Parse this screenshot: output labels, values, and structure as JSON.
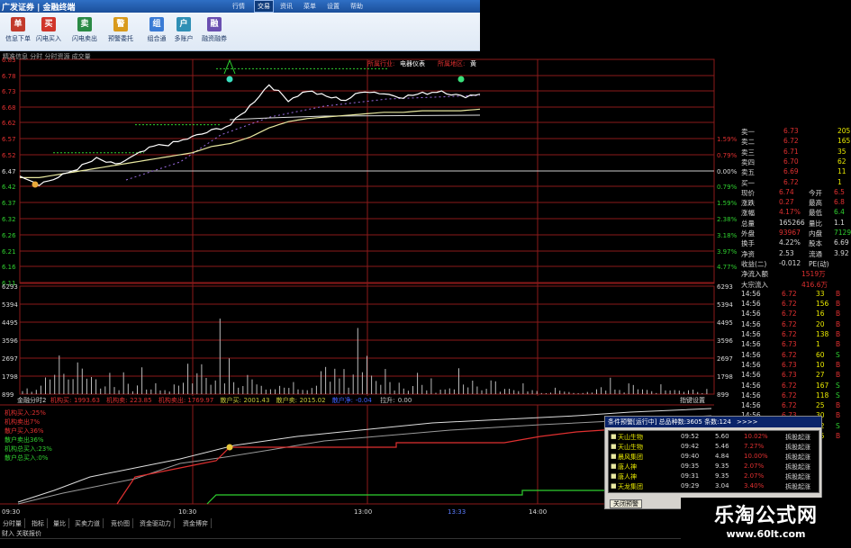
{
  "app": {
    "brand": "广发证券 | 金融终端",
    "menu": [
      "行情",
      "交易",
      "资讯",
      "菜单",
      "设置",
      "帮助"
    ],
    "active_menu": "交易"
  },
  "toolbar": {
    "buttons": [
      {
        "label": "信息下单",
        "icon": "order-icon",
        "glyph": "单",
        "color": "#c23a2b"
      },
      {
        "label": "闪电买入",
        "icon": "buy-icon",
        "glyph": "买",
        "color": "#d0352a"
      },
      {
        "label": "闪电卖出",
        "icon": "sell-icon",
        "glyph": "卖",
        "color": "#2a8a45"
      },
      {
        "label": "预警委托",
        "icon": "alert-icon",
        "glyph": "警",
        "color": "#d99a1b"
      },
      {
        "label": "组合通",
        "icon": "combo-icon",
        "glyph": "组",
        "color": "#3a7bd5"
      },
      {
        "label": "多账户",
        "icon": "accounts-icon",
        "glyph": "户",
        "color": "#2f8fb5"
      },
      {
        "label": "融资融券",
        "icon": "margin-icon",
        "glyph": "融",
        "color": "#6a4fb0"
      }
    ]
  },
  "info_line": "精准信息  分时 分时资源 成交量",
  "header_overlay": {
    "industry_label": "所属行业:",
    "industry": "电器仪表",
    "region_label": "所属地区:",
    "region": "黄"
  },
  "y_axis_left": [
    "6.83",
    "6.78",
    "6.73",
    "6.68",
    "6.62",
    "6.57",
    "6.52",
    "6.47",
    "6.42",
    "6.37",
    "6.32",
    "6.26",
    "6.21",
    "6.16",
    "6.11"
  ],
  "y_axis_right": [
    "1.59%",
    "0.79%",
    "0.00%",
    "0.79%",
    "1.59%",
    "2.38%",
    "3.18%",
    "3.97%",
    "4.77%"
  ],
  "volume_axis": [
    "6293",
    "5394",
    "4495",
    "3596",
    "2697",
    "1798",
    "899"
  ],
  "indicator_bar": {
    "title": "金融分时2",
    "items": [
      {
        "label": "机构买:",
        "value": "1993.63",
        "color": "#e03030"
      },
      {
        "label": "机构卖:",
        "value": "223.85",
        "color": "#e03030"
      },
      {
        "label": "机构卖出:",
        "value": "1769.97",
        "color": "#e03030"
      },
      {
        "label": "散户买:",
        "value": "2001.43",
        "color": "#c8c838"
      },
      {
        "label": "散户卖:",
        "value": "2015.02",
        "color": "#c8c838"
      },
      {
        "label": "散户净:",
        "value": "-0.04",
        "color": "#4060ff"
      },
      {
        "label": "拉升:",
        "value": "0.00",
        "color": "#c8c8c8"
      }
    ],
    "settings_label": "指键设置"
  },
  "legend": [
    {
      "label": "机构买入:25%",
      "color": "#e03030"
    },
    {
      "label": "机构卖出7%",
      "color": "#e03030"
    },
    {
      "label": "散户买入36%",
      "color": "#e03030"
    },
    {
      "label": "散户卖出36%",
      "color": "#2fcf2f"
    },
    {
      "label": "机构总买入:23%",
      "color": "#2fcf2f"
    },
    {
      "label": "散户总买入:0%",
      "color": "#2fcf2f"
    }
  ],
  "time_axis": [
    "09:30",
    "10:30",
    "13:00",
    "13:33",
    "14:00"
  ],
  "quote": {
    "order_book": [
      {
        "label": "卖一",
        "price": "6.73",
        "vol": "205",
        "pcolor": "#e03030"
      },
      {
        "label": "卖二",
        "price": "6.72",
        "vol": "165",
        "pcolor": "#e03030"
      },
      {
        "label": "卖三",
        "price": "6.71",
        "vol": "35",
        "pcolor": "#e03030"
      },
      {
        "label": "卖四",
        "price": "6.70",
        "vol": "62",
        "pcolor": "#e03030"
      },
      {
        "label": "卖五",
        "price": "6.69",
        "vol": "11",
        "pcolor": "#e03030"
      },
      {
        "label": "买一",
        "price": "6.72",
        "vol": "1",
        "pcolor": "#e03030"
      }
    ],
    "stats": [
      {
        "l1": "现价",
        "v1": "6.74",
        "l2": "今开",
        "v2": "6.5",
        "c1": "#e03030",
        "c2": "#e03030"
      },
      {
        "l1": "涨跌",
        "v1": "0.27",
        "l2": "最高",
        "v2": "6.8",
        "c1": "#e03030",
        "c2": "#e03030"
      },
      {
        "l1": "涨幅",
        "v1": "4.17%",
        "l2": "最低",
        "v2": "6.4",
        "c1": "#e03030",
        "c2": "#2fcf2f"
      },
      {
        "l1": "总量",
        "v1": "165266",
        "l2": "量比",
        "v2": "1.1",
        "c1": "#d8d8d8",
        "c2": "#d8d8d8"
      },
      {
        "l1": "外盘",
        "v1": "93967",
        "l2": "内盘",
        "v2": "7129",
        "c1": "#e03030",
        "c2": "#2fcf2f"
      }
    ],
    "stats2": [
      {
        "l1": "换手",
        "v1": "4.22%",
        "l2": "股本",
        "v2": "6.69",
        "c1": "#d8d8d8",
        "c2": "#d8d8d8"
      },
      {
        "l1": "净资",
        "v1": "2.53",
        "l2": "流通",
        "v2": "3.92",
        "c1": "#d8d8d8",
        "c2": "#d8d8d8"
      },
      {
        "l1": "收益(二)",
        "v1": "-0.012",
        "l2": "PE(动)",
        "v2": "",
        "c1": "#d8d8d8",
        "c2": "#d8d8d8"
      }
    ],
    "flows": [
      {
        "label": "净流入额",
        "value": "1519万",
        "color": "#e03030"
      },
      {
        "label": "大宗流入",
        "value": "416.6万",
        "color": "#e03030"
      }
    ],
    "ticks": [
      {
        "time": "14:56",
        "price": "6.72",
        "vol": "33",
        "dir": "B"
      },
      {
        "time": "14:56",
        "price": "6.72",
        "vol": "156",
        "dir": "B"
      },
      {
        "time": "14:56",
        "price": "6.72",
        "vol": "16",
        "dir": "B"
      },
      {
        "time": "14:56",
        "price": "6.72",
        "vol": "20",
        "dir": "B"
      },
      {
        "time": "14:56",
        "price": "6.72",
        "vol": "138",
        "dir": "B"
      },
      {
        "time": "14:56",
        "price": "6.73",
        "vol": "1",
        "dir": "B"
      },
      {
        "time": "14:56",
        "price": "6.72",
        "vol": "60",
        "dir": "S"
      },
      {
        "time": "14:56",
        "price": "6.73",
        "vol": "10",
        "dir": "B"
      },
      {
        "time": "14:56",
        "price": "6.73",
        "vol": "27",
        "dir": "B"
      },
      {
        "time": "14:56",
        "price": "6.72",
        "vol": "167",
        "dir": "S"
      },
      {
        "time": "14:56",
        "price": "6.72",
        "vol": "118",
        "dir": "S"
      },
      {
        "time": "14:56",
        "price": "6.72",
        "vol": "25",
        "dir": "B"
      },
      {
        "time": "14:56",
        "price": "6.73",
        "vol": "30",
        "dir": "B"
      },
      {
        "time": "14:56",
        "price": "6.72",
        "vol": "12",
        "dir": "S"
      },
      {
        "time": "14:56",
        "price": "6.72",
        "vol": "45",
        "dir": "B"
      }
    ]
  },
  "alert": {
    "title": "条件预警[运行中] 总品种数:3605 条数:124",
    "more": ">>>>",
    "rows": [
      {
        "name": "天山生物",
        "time": "09:52",
        "price": "5.60",
        "pct": "10.02%",
        "type": "拆股起涨"
      },
      {
        "name": "天山生物",
        "time": "09:42",
        "price": "5.46",
        "pct": "7.27%",
        "type": "拆股起涨"
      },
      {
        "name": "晨风集团",
        "time": "09:40",
        "price": "4.84",
        "pct": "10.00%",
        "type": "拆股起涨"
      },
      {
        "name": "唐人神",
        "time": "09:35",
        "price": "9.35",
        "pct": "2.07%",
        "type": "拆股起涨"
      },
      {
        "name": "唐人神",
        "time": "09:31",
        "price": "9.35",
        "pct": "2.07%",
        "type": "拆股起涨"
      },
      {
        "name": "天龙集团",
        "time": "09:29",
        "price": "3.04",
        "pct": "3.40%",
        "type": "拆股起涨"
      }
    ],
    "close_label": "关闭预警"
  },
  "tabs": [
    "分时量",
    "指标",
    "量比",
    "买卖力道",
    "竞价图",
    "资金驱动力",
    "资金博弈"
  ],
  "status": {
    "left": "财入",
    "middle": "关联报价"
  },
  "watermark": {
    "name": "乐淘公式网",
    "url": "www.60lt.com"
  },
  "colors": {
    "up": "#e03030",
    "down": "#2fcf2f",
    "price_line": "#ffffff",
    "avg_line": "#e8e8a0",
    "grid": "#8b1a1a"
  },
  "chart_data": {
    "type": "line",
    "title": "",
    "price_series": {
      "name": "分时价格",
      "x": [
        "09:30",
        "09:35",
        "09:40",
        "09:45",
        "09:50",
        "09:55",
        "10:00",
        "10:05",
        "10:10",
        "10:15",
        "10:20",
        "10:25",
        "10:30",
        "10:35",
        "10:40",
        "10:45",
        "10:50",
        "10:55",
        "11:00",
        "11:05",
        "11:10",
        "11:15",
        "11:20",
        "11:25",
        "13:00"
      ],
      "values": [
        6.46,
        6.43,
        6.45,
        6.48,
        6.51,
        6.49,
        6.52,
        6.55,
        6.56,
        6.58,
        6.6,
        6.62,
        6.68,
        6.75,
        6.7,
        6.73,
        6.71,
        6.7,
        6.73,
        6.72,
        6.71,
        6.72,
        6.73,
        6.71,
        6.72
      ]
    },
    "avg_series": {
      "name": "均价",
      "values": [
        6.45,
        6.45,
        6.46,
        6.47,
        6.48,
        6.49,
        6.5,
        6.51,
        6.52,
        6.53,
        6.55,
        6.56,
        6.58,
        6.61,
        6.63,
        6.64,
        6.645,
        6.65,
        6.655,
        6.66,
        6.66,
        6.665,
        6.665,
        6.665,
        6.67
      ]
    },
    "ylim": [
      6.11,
      6.83
    ],
    "volume": [
      300,
      520,
      410,
      600,
      880,
      1600,
      2800,
      1300,
      3400,
      2200,
      1900,
      1100,
      2600,
      4900,
      1500,
      2400,
      1200,
      900,
      700,
      2100,
      1100,
      800,
      1400,
      650,
      500,
      900,
      1700,
      700,
      500,
      1000
    ]
  }
}
